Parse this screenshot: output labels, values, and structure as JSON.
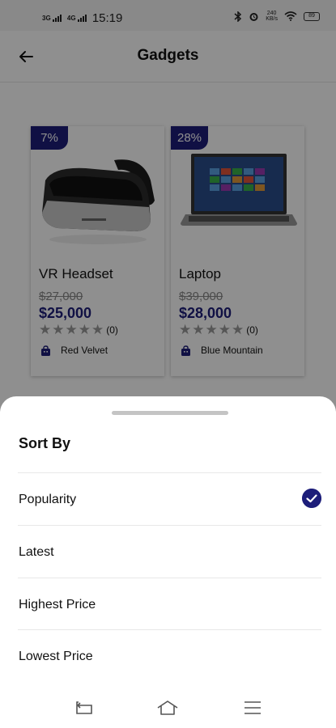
{
  "status_bar": {
    "network_1": "3G",
    "network_2": "4G",
    "time": "15:19",
    "speed_value": "240",
    "speed_unit": "KB/s",
    "battery": "89"
  },
  "app_bar": {
    "title": "Gadgets"
  },
  "products": [
    {
      "discount": "7%",
      "name": "VR Headset",
      "old_price": "$27,000",
      "price": "$25,000",
      "rating_count": "(0)",
      "store": "Red Velvet"
    },
    {
      "discount": "28%",
      "name": "Laptop",
      "old_price": "$39,000",
      "price": "$28,000",
      "rating_count": "(0)",
      "store": "Blue Mountain"
    }
  ],
  "sort_sheet": {
    "title": "Sort By",
    "options": [
      "Popularity",
      "Latest",
      "Highest Price",
      "Lowest Price"
    ],
    "selected": "Popularity"
  },
  "colors": {
    "accent": "#1d1e7a",
    "star": "#9a9a9a",
    "scrim": "#000000"
  }
}
